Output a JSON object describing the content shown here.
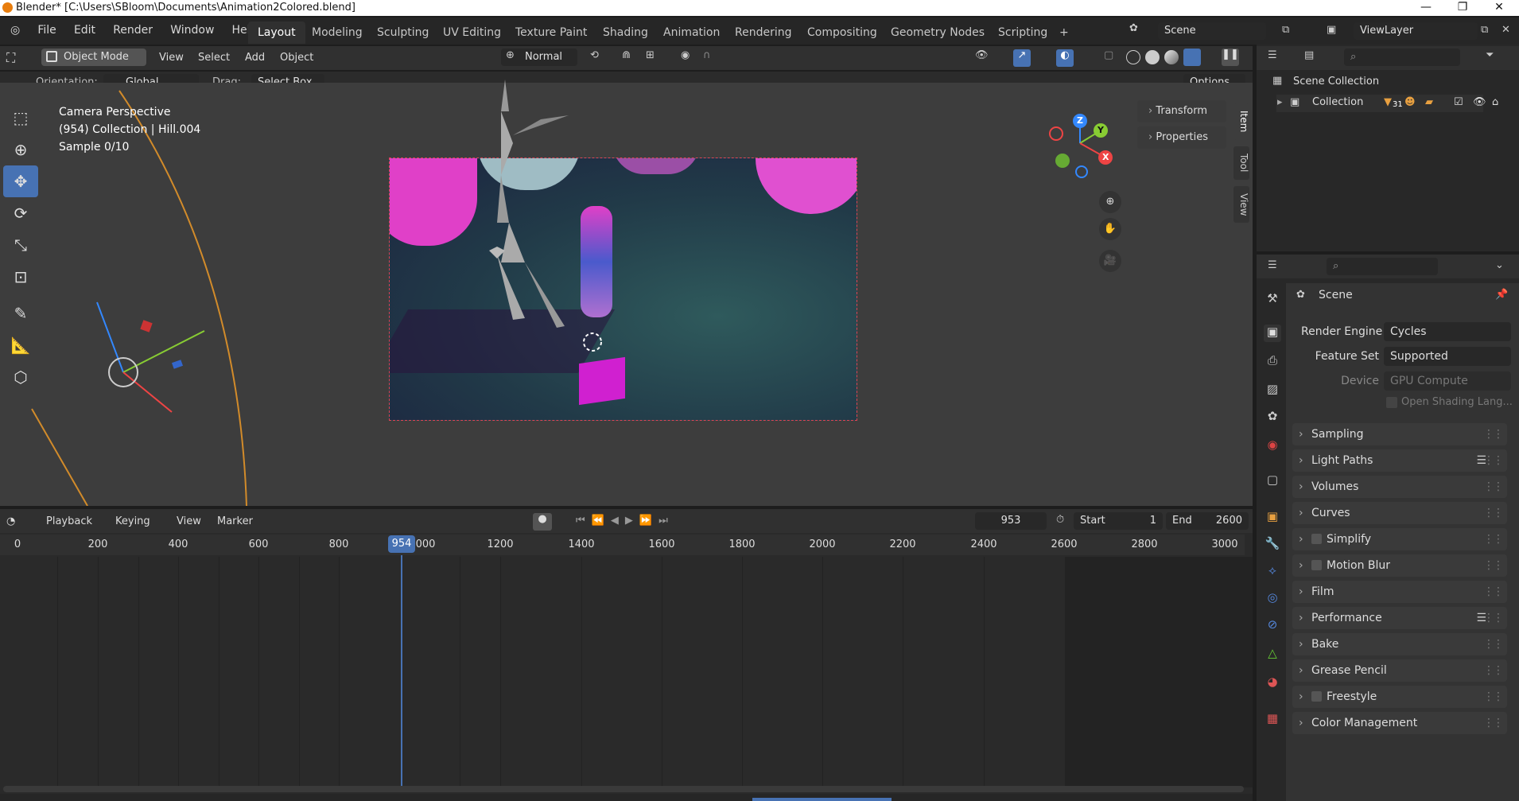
{
  "title_bar": {
    "title": "Blender* [C:\\Users\\SBloom\\Documents\\Animation2Colored.blend]"
  },
  "menu": [
    "File",
    "Edit",
    "Render",
    "Window",
    "Help"
  ],
  "workspaces": [
    "Layout",
    "Modeling",
    "Sculpting",
    "UV Editing",
    "Texture Paint",
    "Shading",
    "Animation",
    "Rendering",
    "Compositing",
    "Geometry Nodes",
    "Scripting",
    "+"
  ],
  "scene_field": "Scene",
  "viewlayer_field": "ViewLayer",
  "viewport_header": {
    "mode": "Object Mode",
    "menus": [
      "View",
      "Select",
      "Add",
      "Object"
    ],
    "transform_orientation": "Normal",
    "orientation_label": "Orientation:",
    "orientation_value": "Global",
    "drag_label": "Drag:",
    "drag_value": "Select Box",
    "options": "Options"
  },
  "viewport_overlay": {
    "line1": "Camera Perspective",
    "line2": "(954) Collection | Hill.004",
    "line3": "Sample 0/10"
  },
  "n_panel": {
    "transform": "Transform",
    "properties": "Properties",
    "tabs": [
      "Item",
      "Tool",
      "View"
    ]
  },
  "gizmo": {
    "z": "Z",
    "y": "Y",
    "x": "X"
  },
  "timeline": {
    "menus": [
      "Playback",
      "Keying",
      "View",
      "Marker"
    ],
    "current_frame": "953",
    "start_label": "Start",
    "start_value": "1",
    "end_label": "End",
    "end_value": "2600",
    "playhead": "954",
    "ruler": [
      "0",
      "200",
      "400",
      "600",
      "800",
      "000",
      "1200",
      "1400",
      "1600",
      "1800",
      "2000",
      "2200",
      "2400",
      "2600",
      "2800",
      "3000"
    ]
  },
  "outliner": {
    "scene_collection": "Scene Collection",
    "collection": "Collection",
    "badge": "31"
  },
  "properties": {
    "context": "Scene",
    "render_engine_label": "Render Engine",
    "render_engine": "Cycles",
    "feature_set_label": "Feature Set",
    "feature_set": "Supported",
    "device_label": "Device",
    "device": "GPU Compute",
    "osl": "Open Shading Lang...",
    "sections": [
      "Sampling",
      "Light Paths",
      "Volumes",
      "Curves",
      "Simplify",
      "Motion Blur",
      "Film",
      "Performance",
      "Bake",
      "Grease Pencil",
      "Freestyle",
      "Color Management"
    ]
  },
  "colors": {
    "accent": "#4772b3",
    "playhead": "#4772b3",
    "x_axis": "#e44",
    "y_axis": "#8c3",
    "z_axis": "#38f"
  }
}
